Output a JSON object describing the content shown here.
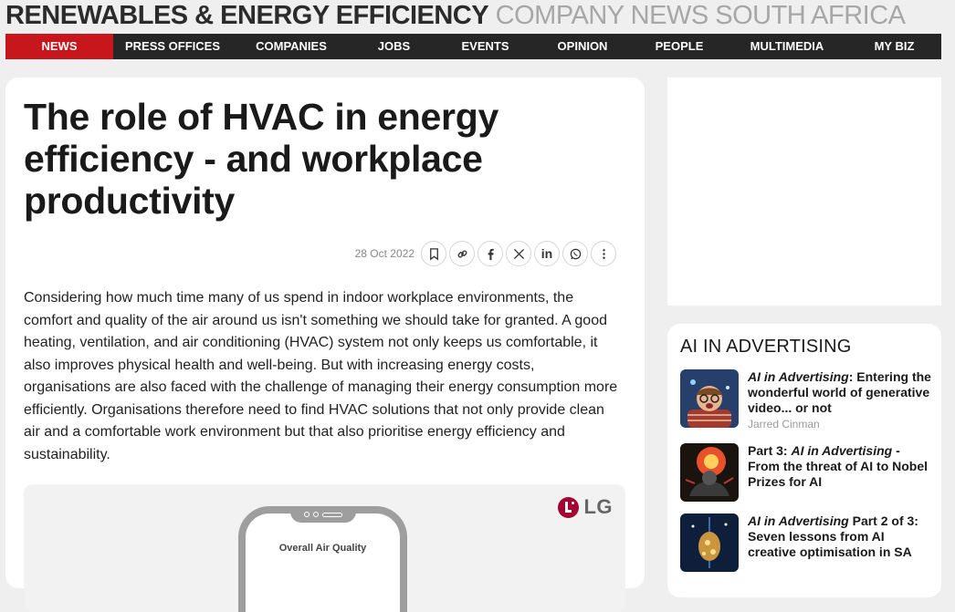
{
  "header": {
    "section": "RENEWABLES & ENERGY EFFICIENCY",
    "region": "COMPANY NEWS SOUTH AFRICA"
  },
  "nav": {
    "active_color": "#c8161d",
    "items": [
      "NEWS",
      "PRESS OFFICES",
      "COMPANIES",
      "JOBS",
      "EVENTS",
      "OPINION",
      "PEOPLE",
      "MULTIMEDIA",
      "MY BIZ"
    ]
  },
  "article": {
    "title": "The role of HVAC in energy efficiency - and workplace productivity",
    "date": "28 Oct 2022",
    "share_icons": [
      "bookmark-icon",
      "link-icon",
      "facebook-icon",
      "x-icon",
      "linkedin-icon",
      "whatsapp-icon",
      "more-icon"
    ],
    "body": "Considering how much time many of us spend in indoor workplace environments, the comfort and quality of the air around us isn't something we should take for granted. A good heating, ventilation, and air conditioning (HVAC) system not only keeps us comfortable, it also improves physical health and well-being. But with increasing energy costs, organisations are also faced with the challenge of managing their energy consumption more efficiently. Organisations therefore need to find HVAC solutions that not only provide clean air and a comfortable work environment but that also prioritise energy efficiency and sustainability.",
    "figure": {
      "brand": "LG",
      "brand_color": "#a50034",
      "phone_screen_title": "Overall Air Quality"
    }
  },
  "sidebar": {
    "title": "AI IN ADVERTISING",
    "stories": [
      {
        "em": "AI in Advertising",
        "pre": "",
        "post": ": Entering the wonderful world of generative video... or not",
        "author": "Jarred Cinman"
      },
      {
        "em": "AI in Advertising",
        "pre": "Part 3: ",
        "post": " - From the threat of AI to Nobel Prizes for AI",
        "author": ""
      },
      {
        "em": "AI in Advertising",
        "pre": "",
        "post": " Part 2 of 3: Seven lessons from AI creative optimisation in SA",
        "author": ""
      }
    ]
  }
}
